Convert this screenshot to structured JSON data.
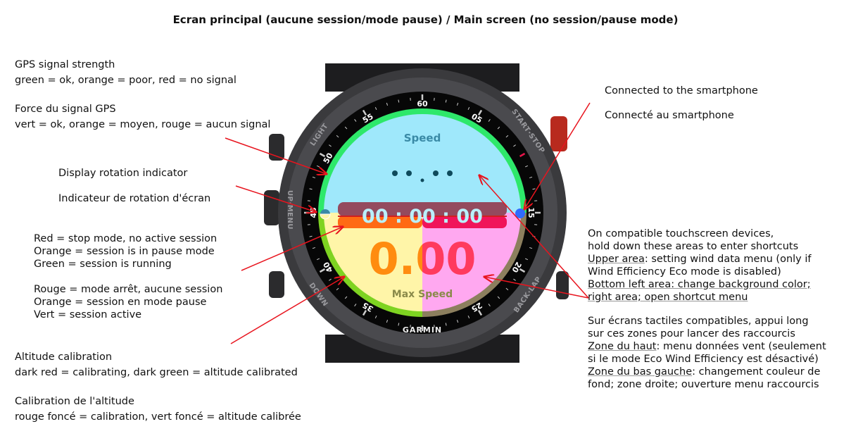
{
  "title": "Ecran principal (aucune session/mode pause) / Main screen (no session/pause mode)",
  "watch": {
    "brand": "GARMIN",
    "buttons": [
      "LIGHT",
      "UP·MENU",
      "DOWN",
      "START·STOP",
      "BACK·LAP"
    ],
    "bezel_numbers": [
      "60",
      "05",
      "15",
      "20",
      "25",
      "35",
      "40",
      "45",
      "50",
      "55"
    ],
    "top_label": "Speed",
    "timer": "00 : 00 : 00",
    "value": "0.00",
    "bottom_label": "Max Speed",
    "colors": {
      "ring_top": "#2ee86a",
      "ring_bottom_left": "#7ed321",
      "ring_bottom_right": "#8c7f5e",
      "upper_bg": "#9fe8fb",
      "lower_left_bg": "#fff5a8",
      "lower_right_bg": "#ffa8f0",
      "timer_bar_left": "#ff6a14",
      "timer_bar_right": "#f0145a",
      "value_left": "#ff8c10",
      "value_right": "#ff3a5e",
      "connected_dot": "#2f6bff",
      "arrow": "#e8141e"
    }
  },
  "annotations": {
    "gps_en": [
      "GPS signal strength",
      "green = ok, orange = poor, red = no signal"
    ],
    "gps_fr": [
      "Force du signal GPS",
      "vert = ok, orange = moyen, rouge = aucun signal"
    ],
    "rotation_en": "Display rotation indicator",
    "rotation_fr": "Indicateur de rotation d'écran",
    "session_en": [
      "Red = stop mode, no active session",
      "Orange = session is in pause mode",
      "Green = session is running"
    ],
    "session_fr": [
      "Rouge = mode arrêt, aucune session",
      "Orange = session en mode pause",
      "Vert = session active"
    ],
    "altitude_en": [
      "Altitude calibration",
      "dark red = calibrating, dark green = altitude calibrated"
    ],
    "altitude_fr": [
      "Calibration de l'altitude",
      "rouge foncé = calibration, vert foncé = altitude calibrée"
    ],
    "phone_en": "Connected to the smartphone",
    "phone_fr": "Connecté au smartphone",
    "touch_en": {
      "l1": "On compatible touchscreen devices,",
      "l2": "hold down these areas to enter shortcuts",
      "l3a": "Upper area",
      "l3b": ": setting wind data menu (only if",
      "l4": "Wind Efficiency Eco mode is disabled)",
      "l5": "Bottom left area: change background color;",
      "l6": "right area; open shortcut menu"
    },
    "touch_fr": {
      "l1": "Sur écrans tactiles compatibles, appui long",
      "l2": "sur ces zones pour lancer des raccourcis",
      "l3a": "Zone du haut",
      "l3b": ": menu données vent (seulement",
      "l4": "si le mode Eco Wind Efficiency est désactivé)",
      "l5a": "Zone du bas gauche",
      "l5b": ": changement couleur de",
      "l6": "fond; zone droite; ouverture menu raccourcis"
    }
  }
}
